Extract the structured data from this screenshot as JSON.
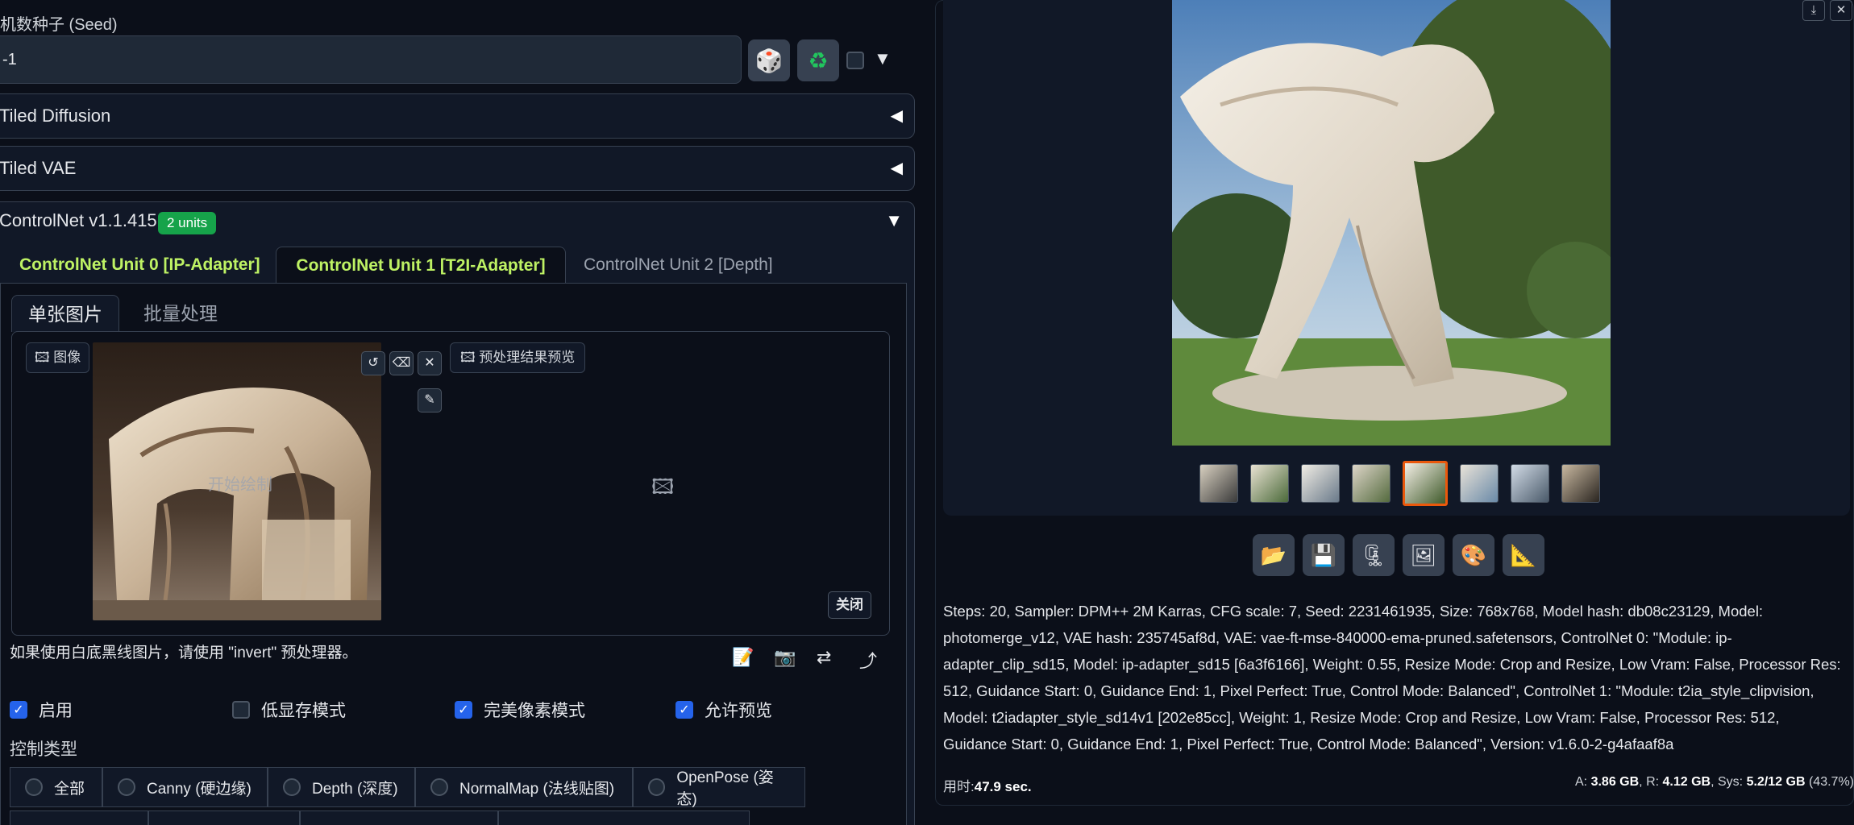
{
  "seed": {
    "label": "机数种子 (Seed)",
    "value": "-1"
  },
  "accordions": {
    "tiled_diffusion": "Tiled Diffusion",
    "tiled_vae": "Tiled VAE"
  },
  "controlnet": {
    "title": "ControlNet v1.1.415",
    "badge": "2 units",
    "tabs": [
      "ControlNet Unit 0 [IP-Adapter]",
      "ControlNet Unit 1 [T2I-Adapter]",
      "ControlNet Unit 2 [Depth]"
    ],
    "subtabs": [
      "单张图片",
      "批量处理"
    ],
    "image_label": "图像",
    "preview_label": "预处理结果预览",
    "start_draw": "开始绘制",
    "close": "关闭",
    "hint": "如果使用白底黑线图片，请使用 \"invert\" 预处理器。",
    "options": [
      {
        "label": "启用",
        "checked": true
      },
      {
        "label": "低显存模式",
        "checked": false
      },
      {
        "label": "完美像素模式",
        "checked": true
      },
      {
        "label": "允许预览",
        "checked": true
      }
    ],
    "control_type_label": "控制类型",
    "control_types": [
      "全部",
      "Canny (硬边缘)",
      "Depth (深度)",
      "NormalMap (法线贴图)",
      "OpenPose (姿态)"
    ]
  },
  "output": {
    "info": "Steps: 20, Sampler: DPM++ 2M Karras, CFG scale: 7, Seed: 2231461935, Size: 768x768, Model hash: db08c23129, Model: photomerge_v12, VAE hash: 235745af8d, VAE: vae-ft-mse-840000-ema-pruned.safetensors, ControlNet 0: \"Module: ip-adapter_clip_sd15, Model: ip-adapter_sd15 [6a3f6166], Weight: 0.55, Resize Mode: Crop and Resize, Low Vram: False, Processor Res: 512, Guidance Start: 0, Guidance End: 1, Pixel Perfect: True, Control Mode: Balanced\", ControlNet 1: \"Module: t2ia_style_clipvision, Model: t2iadapter_style_sd14v1 [202e85cc], Weight: 1, Resize Mode: Crop and Resize, Low Vram: False, Processor Res: 512, Guidance Start: 0, Guidance End: 1, Pixel Perfect: True, Control Mode: Balanced\", Version: v1.6.0-2-g4afaaf8a",
    "time_label": "用时:",
    "time_value": "47.9 sec.",
    "mem_a_label": "A:",
    "mem_a": "3.86 GB",
    "mem_r_label": "R:",
    "mem_r": "4.12 GB",
    "mem_sys_label": "Sys:",
    "mem_sys": "5.2/12 GB",
    "mem_pct": "(43.7%)"
  },
  "colors": {
    "background": "#0b0f19",
    "accent_green": "#bef264",
    "badge_green": "#16a34a",
    "checkbox_blue": "#2563eb",
    "selected_thumb": "#ea580c"
  },
  "icons": [
    "dice-icon",
    "recycle-icon",
    "undo-icon",
    "eraser-icon",
    "close-icon",
    "brush-icon",
    "image-icon",
    "notepad-icon",
    "camera-icon",
    "swap-icon",
    "send-icon",
    "folder-icon",
    "save-icon",
    "zip-icon",
    "picture-icon",
    "palette-icon",
    "ruler-icon",
    "download-icon"
  ]
}
